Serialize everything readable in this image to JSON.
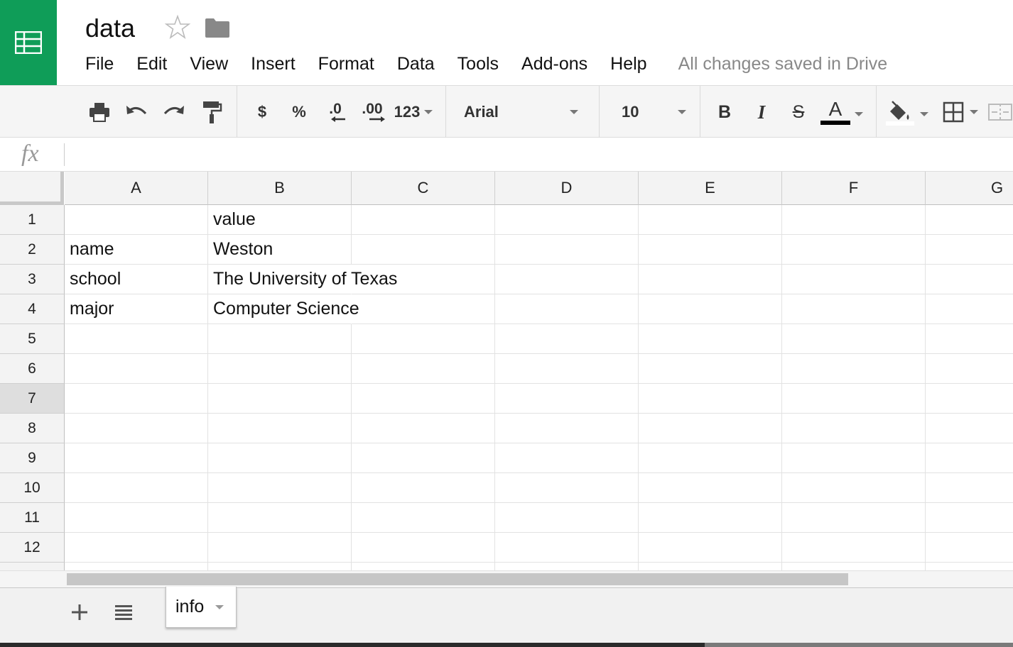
{
  "document": {
    "title": "data",
    "save_status": "All changes saved in Drive"
  },
  "menu": [
    "File",
    "Edit",
    "View",
    "Insert",
    "Format",
    "Data",
    "Tools",
    "Add-ons",
    "Help"
  ],
  "toolbar": {
    "currency": "$",
    "percent": "%",
    "decrease_decimal": ".0",
    "increase_decimal": ".00",
    "more_formats": "123",
    "font": "Arial",
    "font_size": "10",
    "bold": "B",
    "italic": "I",
    "strike": "S",
    "text_color_letter": "A",
    "text_color": "#000000"
  },
  "formula_bar": {
    "label": "fx",
    "value": ""
  },
  "grid": {
    "columns": [
      "A",
      "B",
      "C",
      "D",
      "E",
      "F",
      "G"
    ],
    "rows": [
      "1",
      "2",
      "3",
      "4",
      "5",
      "6",
      "7",
      "8",
      "9",
      "10",
      "11",
      "12"
    ],
    "selected_row": "7",
    "cells": {
      "B1": "value",
      "A2": "name",
      "B2": "Weston",
      "A3": "school",
      "B3": "The University of Texas",
      "A4": "major",
      "B4": "Computer Science"
    }
  },
  "sheets": [
    {
      "name": "info",
      "active": true
    }
  ],
  "colors": {
    "brand": "#0f9d58",
    "header_bg": "#f3f3f3",
    "grid_line": "#e2e2e2"
  }
}
